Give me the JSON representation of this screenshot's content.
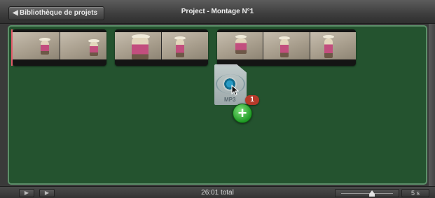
{
  "header": {
    "back_label": "Bibliothèque de projets",
    "title": "Project - Montage N°1"
  },
  "clips": [
    {
      "frames": 2
    },
    {
      "frames": 2
    },
    {
      "frames": 3
    }
  ],
  "drag": {
    "file_ext": "MP3",
    "count": "1"
  },
  "footer": {
    "total": "26:01 total",
    "zoom_label": "5 s",
    "zoom_level": 0.58
  },
  "colors": {
    "timeline_bg": "#24532f",
    "timeline_border": "#5c8f69",
    "badge": "#b63a2a",
    "add": "#1f9a25"
  }
}
